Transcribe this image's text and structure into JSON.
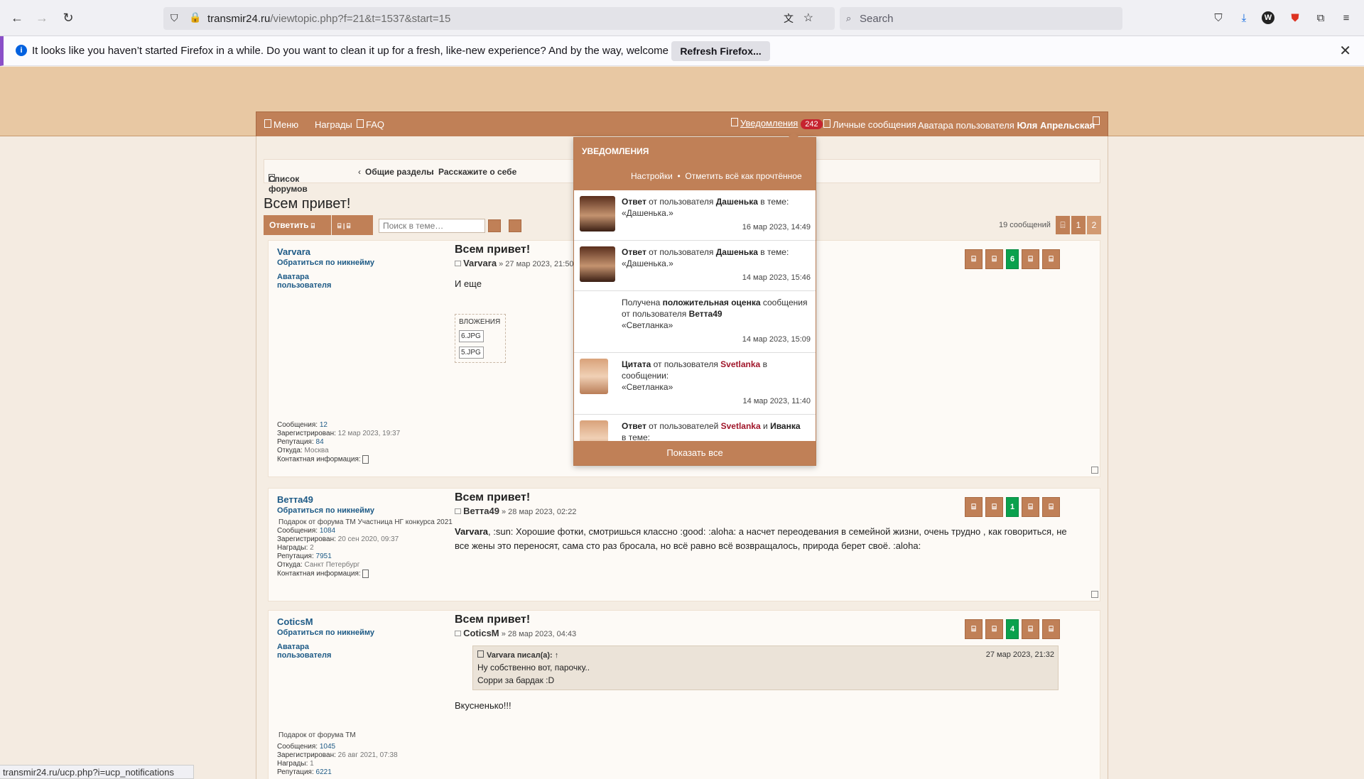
{
  "browser": {
    "url_host": "transmir24.ru",
    "url_path": "/viewtopic.php?f=21&t=1537&start=15",
    "search_placeholder": "Search",
    "status_url": "transmir24.ru/ucp.php?i=ucp_notifications"
  },
  "notification_bar": {
    "message": "It looks like you haven’t started Firefox in a while. Do you want to clean it up for a fresh, like-new experience? And by the way, welcome back!",
    "button": "Refresh Firefox..."
  },
  "nav": {
    "menu": "Меню",
    "awards": "Награды",
    "faq": "FAQ",
    "notifications": "Уведомления",
    "notif_count": "242",
    "messages": "Личные сообщения",
    "avatar_label": "Аватара пользователя",
    "username": "Юля Апрельская"
  },
  "breadcrumbs": [
    "Список форумов",
    "Общие разделы",
    "Расскажите о себе"
  ],
  "topic": {
    "title": "Всем привет!",
    "reply": "Ответить",
    "search_placeholder": "Поиск в теме…",
    "count": "19 сообщений",
    "pages": [
      "1",
      "2"
    ]
  },
  "popup": {
    "title": "УВЕДОМЛЕНИЯ",
    "settings": "Настройки",
    "mark_all": "Отметить всё как прочтённое",
    "show_all": "Показать все",
    "items": [
      {
        "pre": "Ответ",
        "mid": "от пользователя",
        "user": "Дашенька",
        "post": "в теме:",
        "topic": "«Дашенька.»",
        "date": "16 мар 2023, 14:49"
      },
      {
        "pre": "Ответ",
        "mid": "от пользователя",
        "user": "Дашенька",
        "post": "в теме:",
        "topic": "«Дашенька.»",
        "date": "14 мар 2023, 15:46"
      },
      {
        "a": "Получена",
        "b": "положительная оценка",
        "c": "сообщения от пользователя",
        "user": "Ветта49",
        "topic": "«Светланка»",
        "date": "14 мар 2023, 15:09"
      },
      {
        "pre": "Цитата",
        "mid": "от пользователя",
        "user": "Svetlanka",
        "post": "в сообщении:",
        "topic": "«Светланка»",
        "date": "14 мар 2023, 11:40"
      },
      {
        "pre": "Ответ",
        "mid": "от пользователей",
        "user": "Svetlanka",
        "and": "и",
        "user2": "Иванка",
        "post": "в теме:"
      }
    ]
  },
  "posts": [
    {
      "author": "Varvara",
      "nick": "Обратиться по никнейму",
      "avatar": "Аватара пользователя",
      "title": "Всем привет!",
      "meta_user": "Varvara",
      "meta_date": "» 27 мар 2023, 21:50",
      "text": "И еще",
      "attach_label": "ВЛОЖЕНИЯ",
      "files": [
        "6.JPG",
        "5.JPG"
      ],
      "rating": "6",
      "stats": {
        "msgs_l": "Сообщения:",
        "msgs": "12",
        "reg_l": "Зарегистрирован:",
        "reg": "12 мар 2023, 19:37",
        "rep_l": "Репутация:",
        "rep": "84",
        "from_l": "Откуда:",
        "from": "Москва",
        "contact": "Контактная информация:"
      }
    },
    {
      "author": "Ветта49",
      "nick": "Обратиться по никнейму",
      "gift": "Подарок от форума ТМ Участница НГ конкурса 2021",
      "title": "Всем привет!",
      "meta_user": "Ветта49",
      "meta_date": "» 28 мар 2023, 02:22",
      "text_user": "Varvara",
      "text": ", :sun: Хорошие фотки, смотришься классно :good: :aloha: а насчет переодевания в семейной жизни, очень трудно , как говориться, не все жены это переносят, сама сто раз бросала, но всё равно всё возвращалось, природа берет своё. :aloha:",
      "rating": "1",
      "stats": {
        "msgs_l": "Сообщения:",
        "msgs": "1084",
        "reg_l": "Зарегистрирован:",
        "reg": "20 сен 2020, 09:37",
        "aw_l": "Награды:",
        "aw": "2",
        "rep_l": "Репутация:",
        "rep": "7951",
        "from_l": "Откуда:",
        "from": "Санкт Петербург",
        "contact": "Контактная информация:"
      }
    },
    {
      "author": "CoticsM",
      "nick": "Обратиться по никнейму",
      "avatar": "Аватара пользователя",
      "gift": "Подарок от форума ТМ",
      "title": "Всем привет!",
      "meta_user": "CoticsM",
      "meta_date": "» 28 мар 2023, 04:43",
      "quote_who": "Varvara писал(а): ↑",
      "quote_date": "27 мар 2023, 21:32",
      "quote_l1": "Ну собственно вот, парочку..",
      "quote_l2": "Сорри за бардак :D",
      "text": "Вкусненько!!!",
      "rating": "4",
      "stats": {
        "msgs_l": "Сообщения:",
        "msgs": "1045",
        "reg_l": "Зарегистрирован:",
        "reg": "26 авг 2021, 07:38",
        "aw_l": "Награды:",
        "aw": "1",
        "rep_l": "Репутация:",
        "rep": "6221"
      }
    }
  ]
}
